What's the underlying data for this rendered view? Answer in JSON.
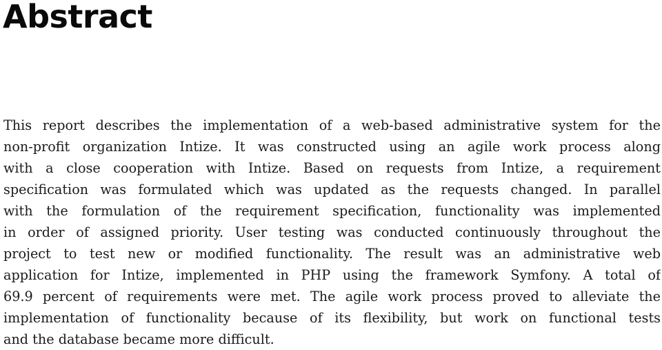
{
  "document": {
    "heading": "Abstract",
    "paragraph_lines": [
      "This report describes the implementation of a web-based administrative system for the",
      "non-profit organization Intize.  It was constructed using an agile work process along",
      "with a close cooperation with Intize.  Based on requests from Intize, a requirement",
      "specification was formulated which was updated as the requests changed.  In parallel",
      "with the formulation of the requirement specification, functionality was implemented",
      "in order of assigned priority.  User testing was conducted continuously throughout the",
      "project to test new or modified functionality.  The result was an administrative web",
      "application for Intize, implemented in PHP using the framework Symfony.  A total of",
      "69.9 percent of requirements were met.  The agile work process proved to alleviate the",
      "implementation of functionality because of its flexibility, but work on functional tests",
      "and the database became more difficult."
    ],
    "requirements_met_percent": 69.9
  }
}
